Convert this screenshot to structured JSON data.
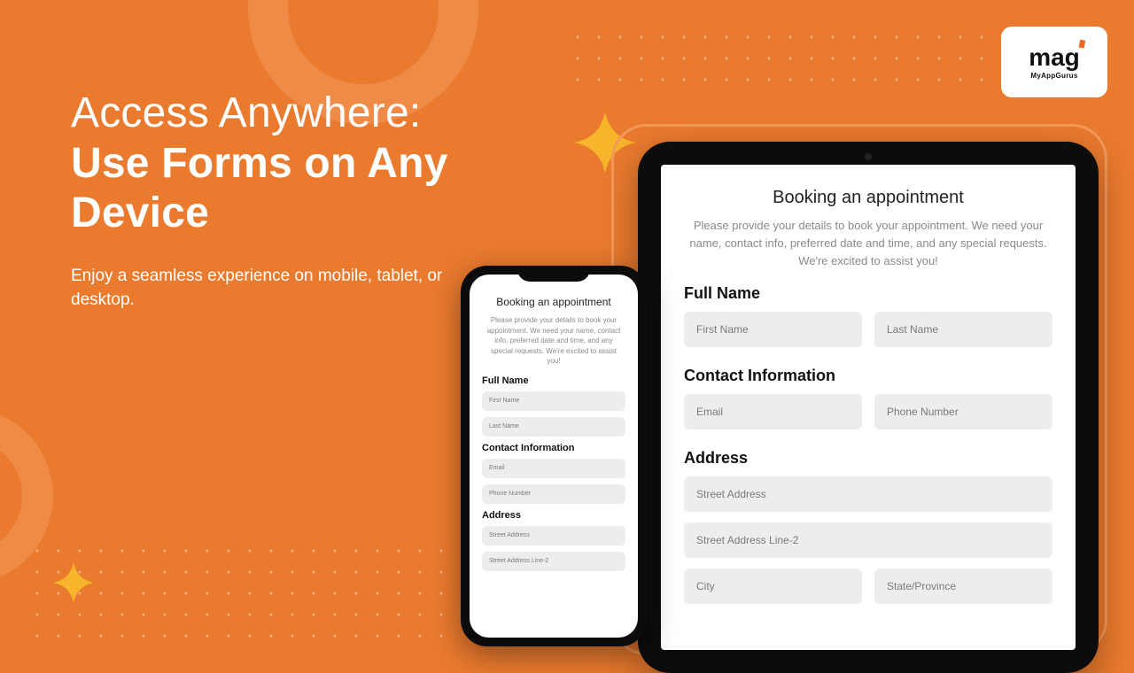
{
  "brand": {
    "name": "mag",
    "sub": "MyAppGurus"
  },
  "headline": {
    "light": "Access Anywhere: ",
    "bold": "Use Forms on Any Device"
  },
  "subhead": "Enjoy a seamless experience on mobile, tablet, or desktop.",
  "form": {
    "title": "Booking an appointment",
    "intro": "Please provide your details to book your appointment. We need your name, contact info, preferred date and time, and any special requests. We're excited to assist you!",
    "sections": {
      "name": "Full Name",
      "contact": "Contact Information",
      "address": "Address"
    },
    "placeholders": {
      "first": "First Name",
      "last": "Last Name",
      "email": "Email",
      "phone": "Phone Number",
      "street1": "Street Address",
      "street2": "Street Address Line-2",
      "city": "City",
      "state": "State/Province"
    }
  },
  "colors": {
    "accent": "#EA7A2E",
    "sparkle": "#F7B52B"
  }
}
